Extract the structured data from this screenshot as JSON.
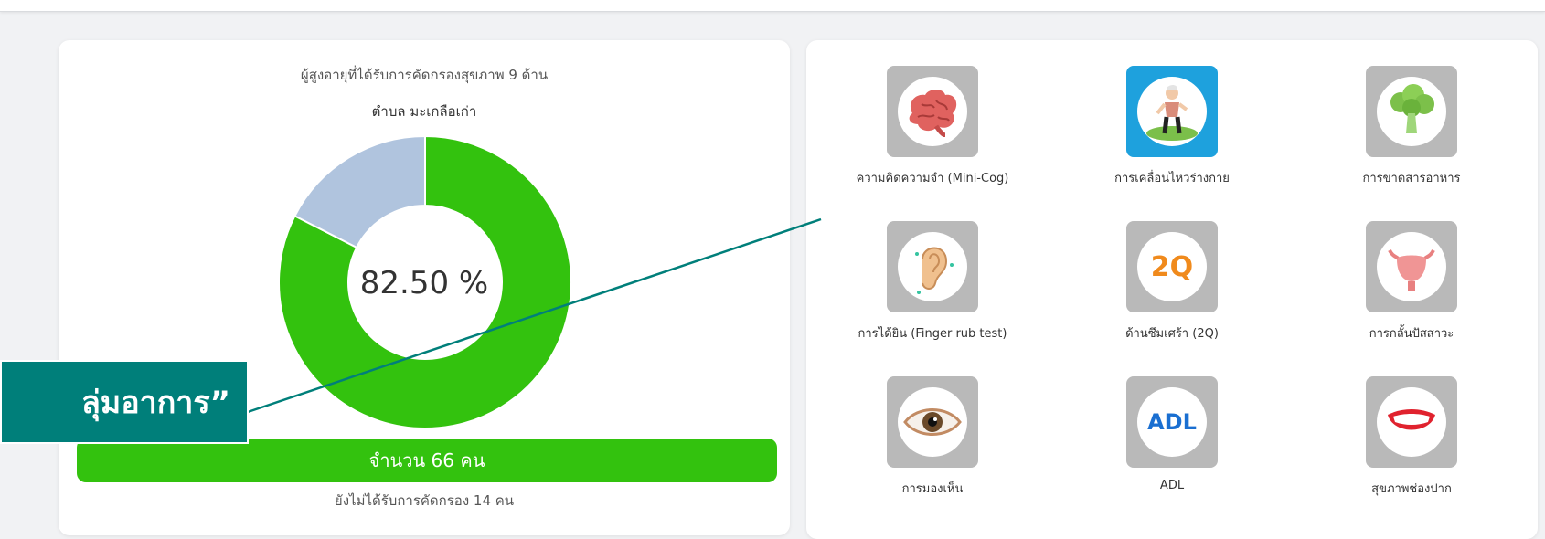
{
  "screening_chart": {
    "title": "ผู้สูงอายุที่ได้รับการคัดกรองสุขภาพ 9 ด้าน",
    "subtitle": "ตำบล มะเกลือเก่า",
    "center_label": "82.50 %",
    "count_label": "จำนวน 66 คน",
    "not_screened_label": "ยังไม่ได้รับการคัดกรอง 14 คน"
  },
  "chart_data": {
    "type": "pie",
    "categories": [
      "",
      ""
    ],
    "values": [
      82.5,
      17.5
    ],
    "title": "ผู้สูงอายุที่ได้รับการคัดกรองสุขภาพ 9 ด้าน"
  },
  "screening_icons": [
    {
      "label": "ความคิดความจำ (Mini-Cog)",
      "icon": "brain-icon",
      "active": false
    },
    {
      "label": "การเคลื่อนไหวร่างกาย",
      "icon": "elderly-walking-icon",
      "active": true
    },
    {
      "label": "การขาดสารอาหาร",
      "icon": "broccoli-icon",
      "active": false
    },
    {
      "label": "การได้ยิน (Finger rub test)",
      "icon": "ear-icon",
      "active": false
    },
    {
      "label": "ด้านซึมเศร้า (2Q)",
      "icon": "2q-icon",
      "active": false,
      "icon_text": "2Q"
    },
    {
      "label": "การกลั้นปัสสาวะ",
      "icon": "bladder-icon",
      "active": false
    },
    {
      "label": "การมองเห็น",
      "icon": "eye-icon",
      "active": false
    },
    {
      "label": "ADL",
      "icon": "adl-icon",
      "active": false,
      "icon_text": "ADL"
    },
    {
      "label": "สุขภาพช่องปาก",
      "icon": "mouth-icon",
      "active": false
    }
  ],
  "callout": {
    "text": "ลุ่มอาการ”"
  },
  "colors": {
    "screened": "#33c20e",
    "not_screened": "#b0c4de",
    "active_icon_bg": "#1ea1dd",
    "inactive_icon_bg": "#b9b9b9",
    "callout_bg": "#007f7a"
  }
}
